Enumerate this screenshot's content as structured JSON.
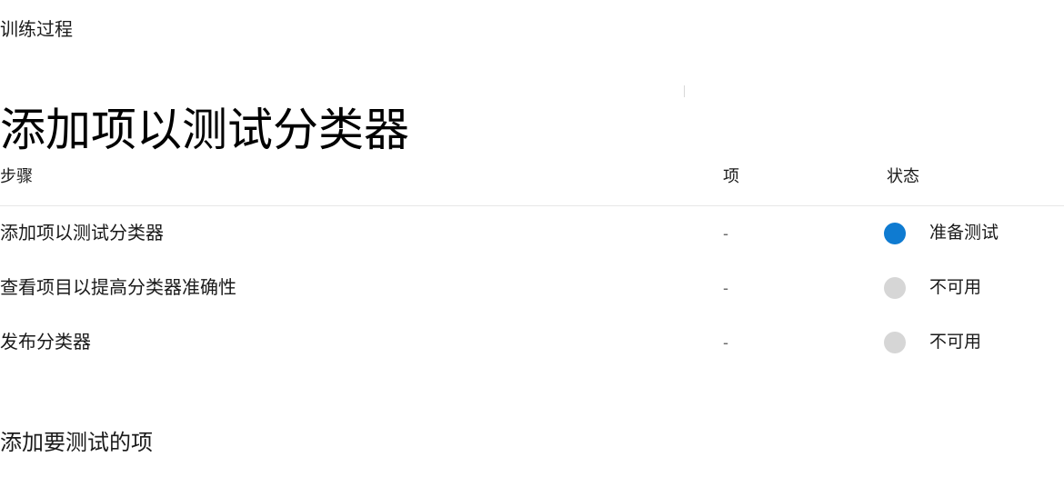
{
  "breadcrumb": {
    "label": "训练过程"
  },
  "page": {
    "title": "添加项以测试分类器"
  },
  "colors": {
    "status_active": "#0f7bd1",
    "status_inactive": "#d6d6d6",
    "divider": "#e7e7e7",
    "text": "#1a1a1a",
    "muted_text": "#6a6a6a"
  },
  "steps_table": {
    "columns": [
      {
        "key": "step",
        "label": "步骤"
      },
      {
        "key": "item",
        "label": "项"
      },
      {
        "key": "status",
        "label": "状态"
      }
    ],
    "rows": [
      {
        "step": "添加项以测试分类器",
        "item": "-",
        "status_label": "准备测试",
        "status_state": "active",
        "status_color": "#0f7bd1"
      },
      {
        "step": "查看项目以提高分类器准确性",
        "item": "-",
        "status_label": "不可用",
        "status_state": "inactive",
        "status_color": "#d6d6d6"
      },
      {
        "step": "发布分类器",
        "item": "-",
        "status_label": "不可用",
        "status_state": "inactive",
        "status_color": "#d6d6d6"
      }
    ]
  },
  "add_items_section": {
    "heading": "添加要测试的项"
  }
}
